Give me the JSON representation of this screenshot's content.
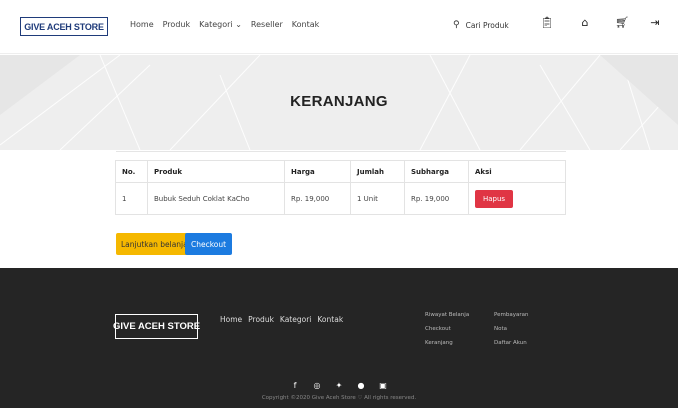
{
  "navbar": {
    "brand": "GIVE ACEH STORE",
    "links": [
      "Home",
      "Produk",
      "Kategori ⌄",
      "Reseller",
      "Kontak"
    ],
    "search_label": "Cari Produk",
    "icons": [
      "search-icon",
      "clipboard-icon",
      "home-icon",
      "cart-icon",
      "logout-icon"
    ]
  },
  "hero": {
    "title": "KERANJANG"
  },
  "cart": {
    "headers": [
      "No.",
      "Produk",
      "Harga",
      "Jumlah",
      "Subharga",
      "Aksi"
    ],
    "rows": [
      {
        "no": "1",
        "produk": "Bubuk Seduh Coklat KaCho",
        "harga": "Rp. 19,000",
        "jumlah": "1 Unit",
        "subharga": "Rp. 19,000",
        "aksi": "Hapus"
      }
    ],
    "continue_label": "Lanjutkan belanja",
    "checkout_label": "Checkout"
  },
  "footer": {
    "brand": "GIVE ACEH STORE",
    "links": [
      "Home",
      "Produk",
      "Kategori",
      "Kontak"
    ],
    "col1": [
      "Riwayat Belanja",
      "Checkout",
      "Keranjang"
    ],
    "col2": [
      "Pembayaran",
      "Nota",
      "Daftar Akun"
    ],
    "social_icons": [
      "facebook-icon",
      "instagram-icon",
      "twitter-icon",
      "dribbble-icon",
      "youtube-icon"
    ],
    "copyright": "Copyright ©2020 Give Aceh Store ♡ All rights reserved."
  },
  "colors": {
    "danger": "#e03544",
    "warning": "#f5b800",
    "primary": "#1c7be0",
    "footer_bg": "#252525",
    "brand": "#1f3b7a"
  }
}
